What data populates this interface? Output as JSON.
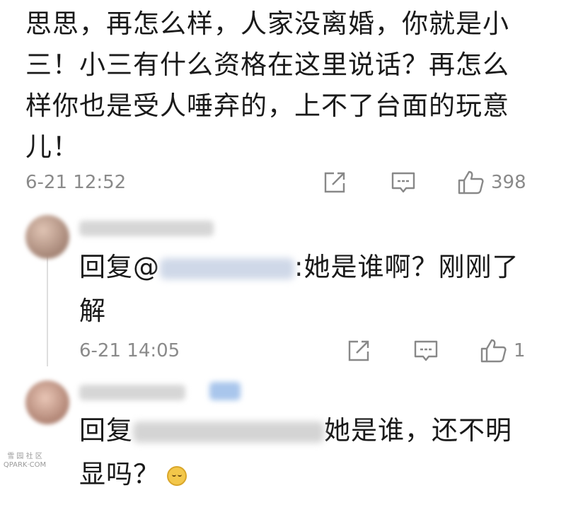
{
  "main_comment": {
    "lines": [
      "思思，再怎么样，人家没离婚，你就是小",
      "三！小三有什么资格在这里说话？再怎么",
      "样你也是受人唾弃的，上不了台面的玩意",
      "儿！"
    ],
    "timestamp": "6-21 12:52",
    "like_count": "398"
  },
  "replies": [
    {
      "prefix": "回复@",
      "text_after_mention": ":她是谁啊？刚刚了",
      "text_line2": "解",
      "timestamp": "6-21 14:05",
      "like_count": "1"
    },
    {
      "prefix": "回复",
      "text_after_mention": "她是谁，还不明",
      "text_line2": "显吗？"
    }
  ],
  "icons": {
    "share": "share-icon",
    "comment": "comment-icon",
    "like": "thumbs-up-icon",
    "emoji": "crying-laughing-emoji-icon"
  },
  "colors": {
    "text": "#1a1a1a",
    "meta": "#8a8a8a",
    "thread_line": "#dedede"
  },
  "watermark": {
    "line1": "雪 园 社 区",
    "line2": "QPARK·COM"
  }
}
